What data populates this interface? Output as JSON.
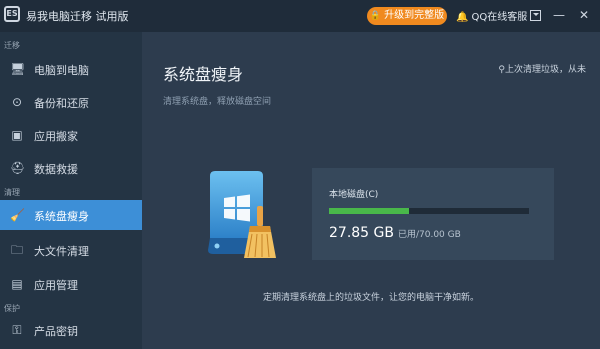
{
  "window": {
    "title": "易我电脑迁移 试用版",
    "upgrade_label": "升级到完整版",
    "qq_service": "QQ在线客服",
    "minimize": "—",
    "close": "✕"
  },
  "sidebar": {
    "sections": [
      {
        "label": "迁移"
      },
      {
        "label": "清理"
      },
      {
        "label": "保护"
      }
    ],
    "items": [
      {
        "label": "电脑到电脑",
        "icon": "monitor-icon"
      },
      {
        "label": "备份和还原",
        "icon": "backup-icon"
      },
      {
        "label": "应用搬家",
        "icon": "app-move-icon"
      },
      {
        "label": "数据救援",
        "icon": "rescue-icon"
      },
      {
        "label": "系统盘瘦身",
        "icon": "broom-icon",
        "active": true
      },
      {
        "label": "大文件清理",
        "icon": "folder-icon"
      },
      {
        "label": "应用管理",
        "icon": "app-manage-icon"
      },
      {
        "label": "产品密钥",
        "icon": "key-icon"
      }
    ]
  },
  "main": {
    "title": "系统盘瘦身",
    "subtitle": "清理系统盘，释放磁盘空间",
    "last_clean": "上次清理垃圾，从未",
    "disk": {
      "name": "本地磁盘(C)",
      "used": "27.85 GB",
      "total": "已用/70.00 GB",
      "used_fraction": 0.4
    },
    "footer": "定期清理系统盘上的垃圾文件，让您的电脑干净如新。"
  },
  "colors": {
    "accent": "#3d8fd7",
    "upgrade": "#f08a1f",
    "progress": "#49b84a"
  }
}
